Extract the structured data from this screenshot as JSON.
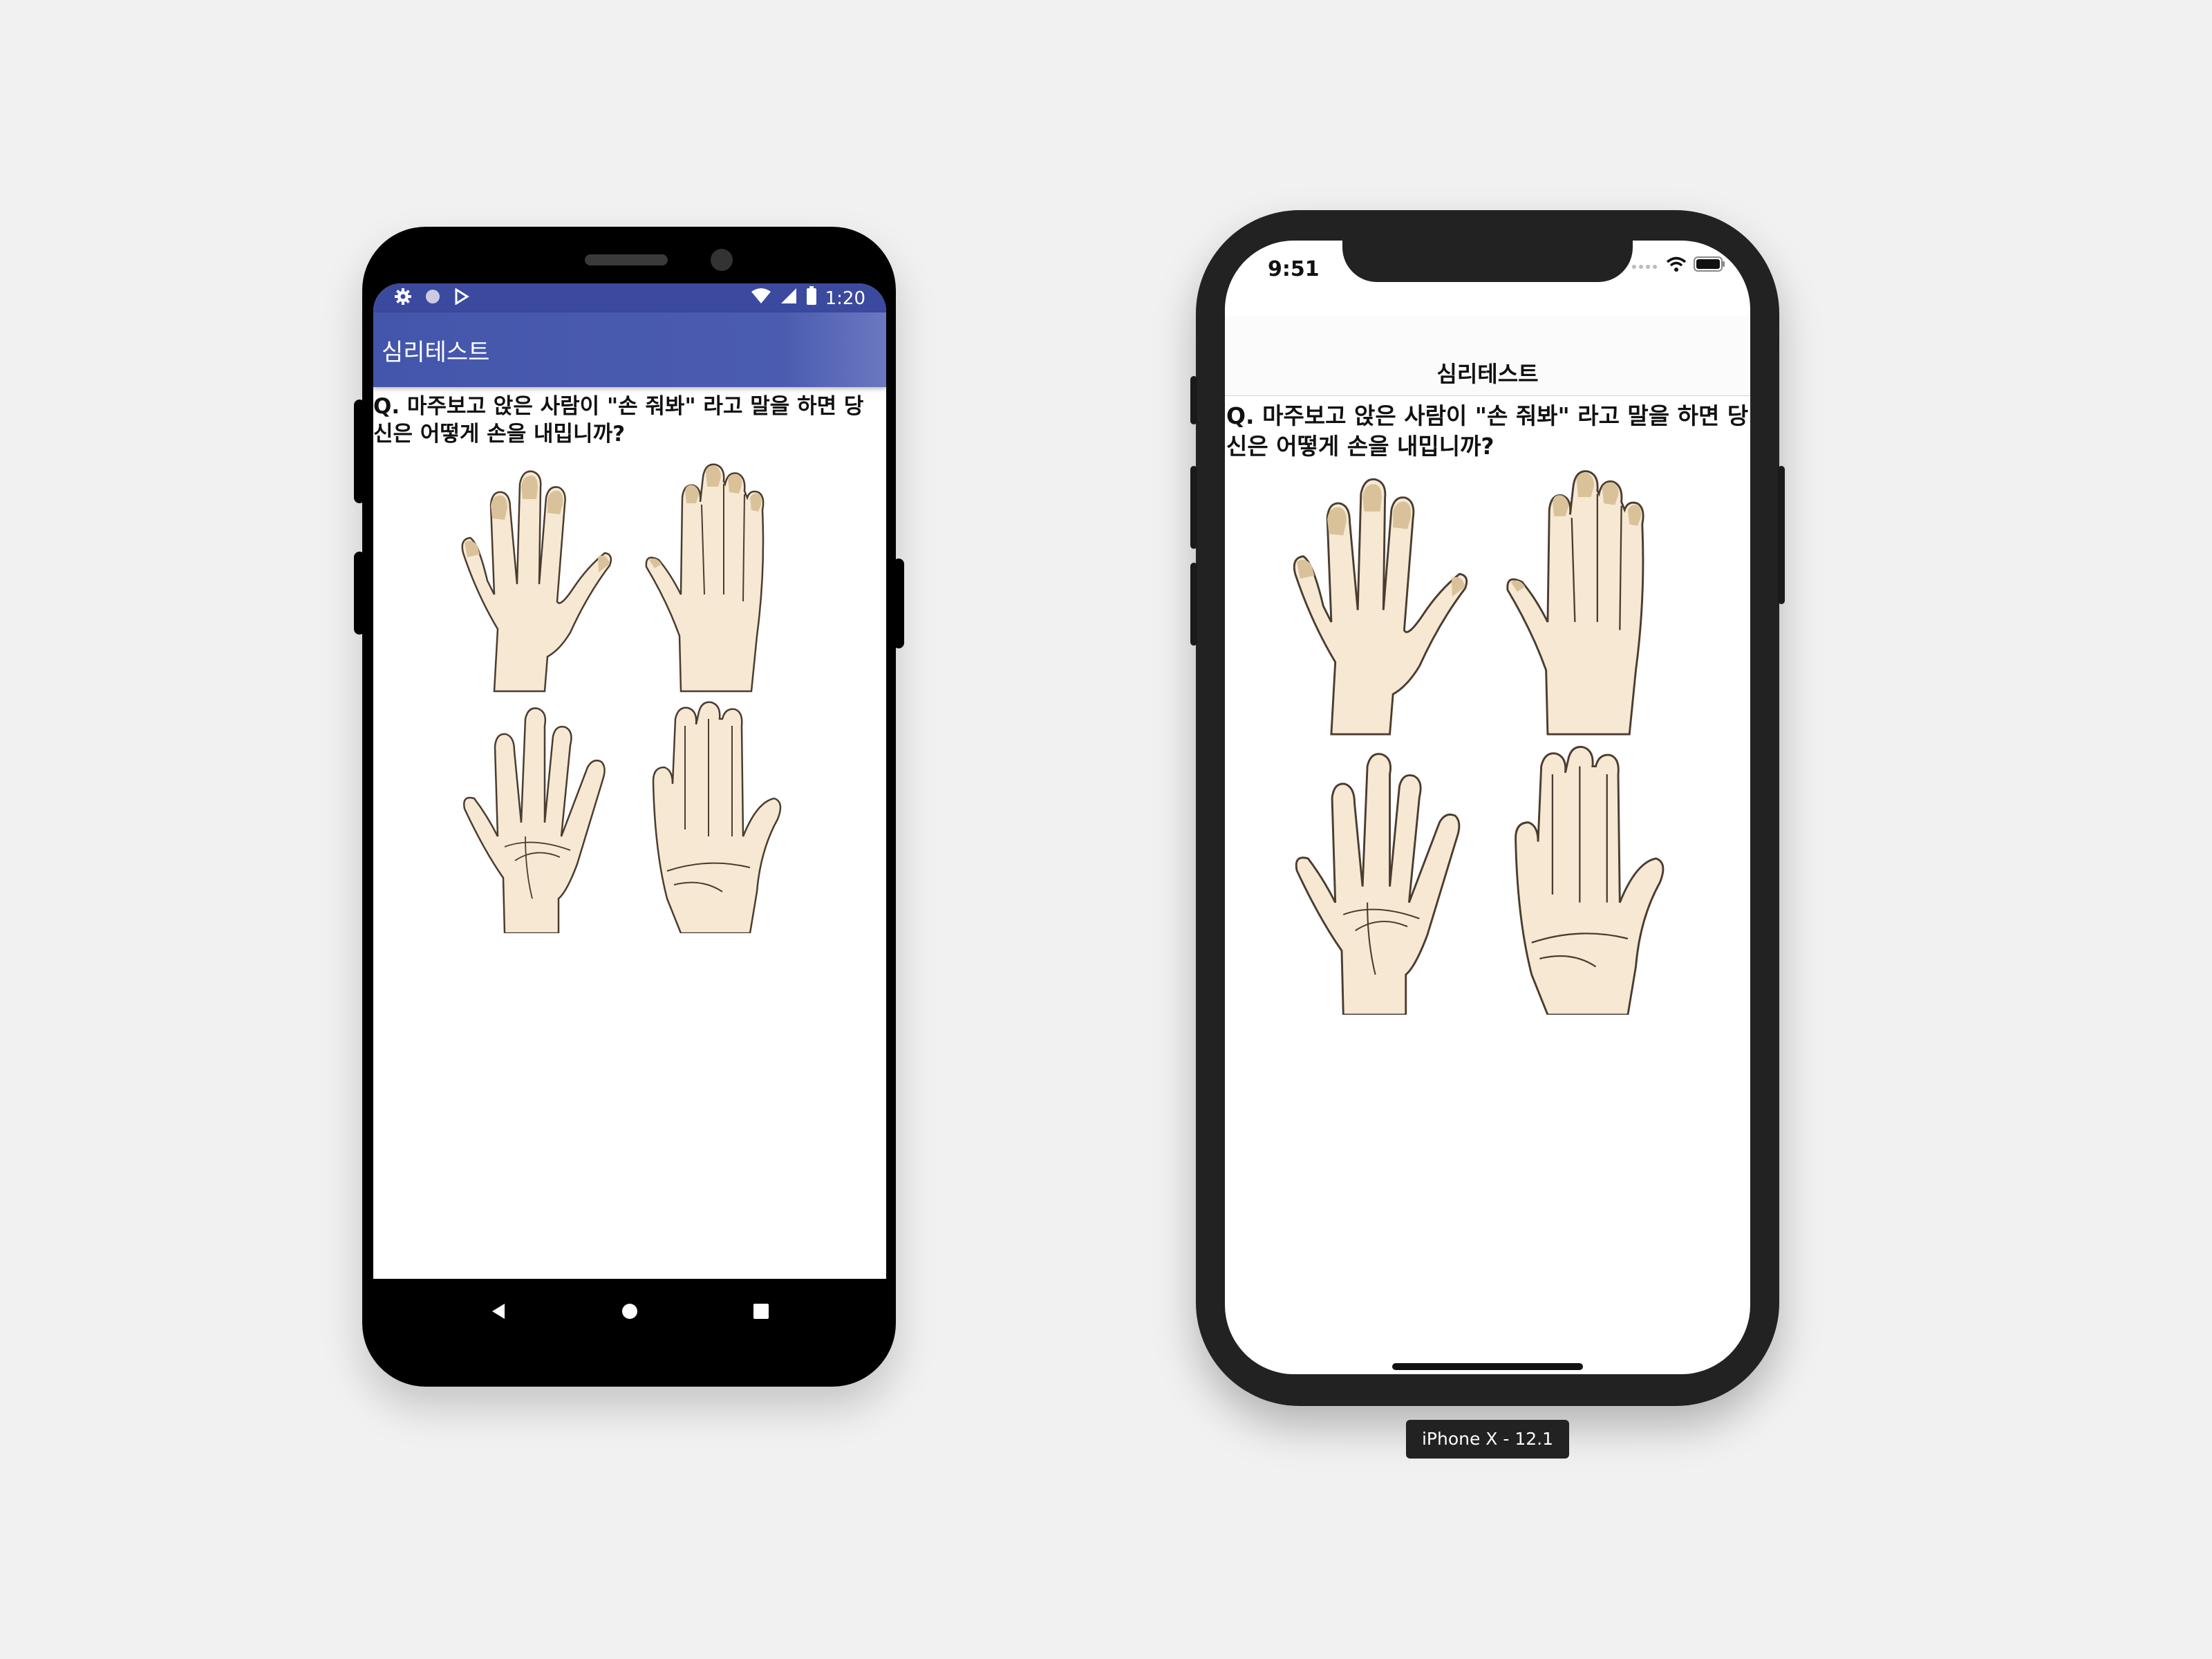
{
  "android": {
    "status": {
      "time": "1:20"
    },
    "app_title": "심리테스트",
    "question": "Q. 마주보고 앉은 사람이 \"손 줘봐\" 라고 말을 하면 당신은 어떻게 손을 내밉니까?"
  },
  "iphone": {
    "status": {
      "time": "9:51"
    },
    "nav_title": "심리테스트",
    "question": "Q. 마주보고 앉은 사람이 \"손 줘봐\" 라고 말을 하면 당신은 어떻게 손을 내밉니까?",
    "device_label": "iPhone X - 12.1"
  },
  "colors": {
    "android_appbar": "#4456ab",
    "android_status": "#3b4a9e",
    "skin": "#f6e8d2",
    "nail": "#d9c29a",
    "outline": "#4a3d30"
  },
  "icons": [
    "settings-icon",
    "circle-icon",
    "play-store-icon",
    "wifi-icon",
    "signal-icon",
    "battery-icon",
    "back-icon",
    "home-icon",
    "recents-icon",
    "cellular-dots-icon"
  ]
}
